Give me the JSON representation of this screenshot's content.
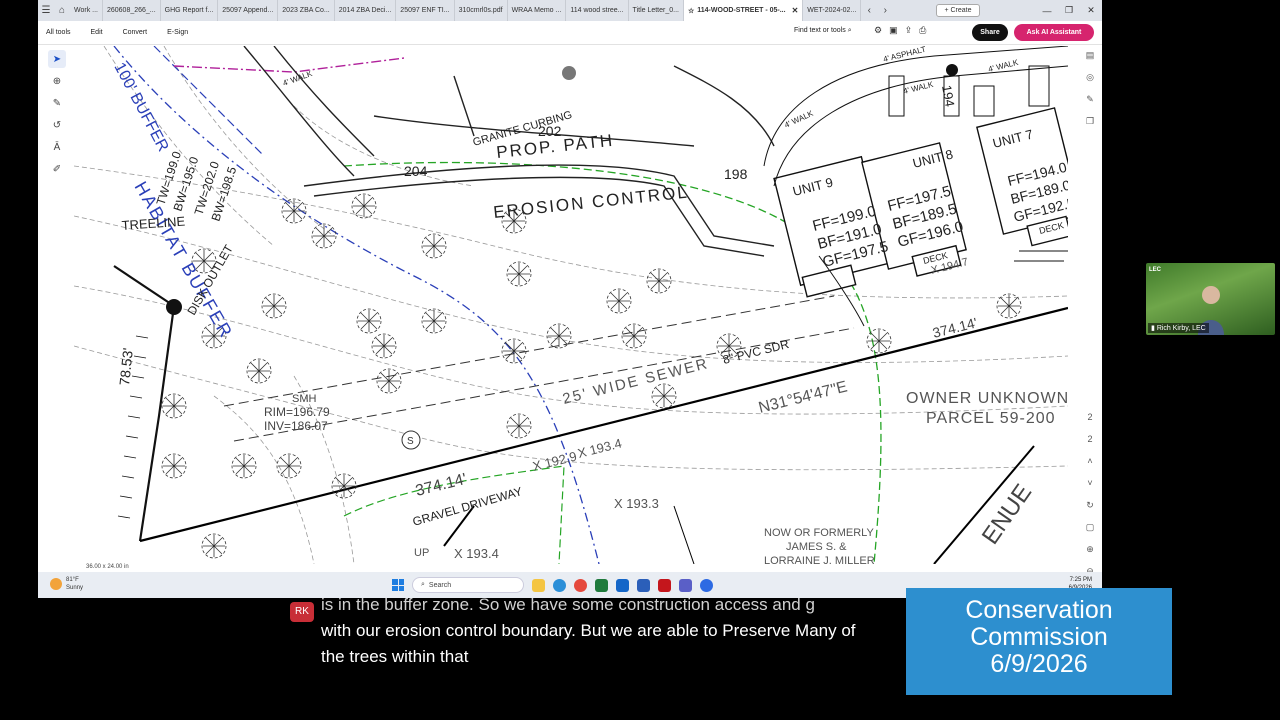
{
  "browser": {
    "tabs": [
      {
        "label": "Work ..."
      },
      {
        "label": "260608_266_..."
      },
      {
        "label": "GHG Report f..."
      },
      {
        "label": "25097 Append..."
      },
      {
        "label": "2023 ZBA Co..."
      },
      {
        "label": "2014 ZBA Deci..."
      },
      {
        "label": "25097 ENF TI..."
      },
      {
        "label": "310cmrl0s.pdf"
      },
      {
        "label": "WRAA Memo ..."
      },
      {
        "label": "114 wood stree..."
      },
      {
        "label": "Title Letter_0..."
      },
      {
        "label": "114-WOOD-STREET - 05-..."
      },
      {
        "label": "WET-2024-02..."
      }
    ],
    "create_label": "+ Create"
  },
  "toolbar": {
    "menu": [
      "All tools",
      "Edit",
      "Convert",
      "E-Sign"
    ],
    "find_label": "Find text or tools",
    "share_label": "Share",
    "ai_label": "Ask AI Assistant"
  },
  "drawing": {
    "labels": {
      "habitat_buffer": "HABITAT BUFFER",
      "buffer_100": "100' BUFFER",
      "granite_curbing": "GRANITE CURBING",
      "prop_path": "PROP. PATH",
      "erosion_control": "EROSION CONTROL",
      "treeline": "TREELINE",
      "disk_outlet": "DISK OUTLET",
      "unit9": "UNIT 9",
      "unit8": "UNIT 8",
      "unit7": "UNIT 7",
      "unit9_ff": "FF=199.0",
      "unit9_bf": "BF=191.0",
      "unit9_gf": "GF=197.5",
      "unit8_ff": "FF=197.5",
      "unit8_bf": "BF=189.5",
      "unit8_gf": "GF=196.0",
      "unit7_ff": "FF=194.0",
      "unit7_bf": "BF=189.0",
      "unit7_gf": "GF=192.5",
      "deck": "DECK",
      "walk": "4' WALK",
      "asphalt": "4' ASPHALT",
      "sewer": "25' WIDE SEWER",
      "pvc": "8\" PVC SDR",
      "bearing": "N31°54'47\"E",
      "owner": "OWNER UNKNOWN",
      "parcel": "PARCEL 59-200",
      "formerly": "NOW OR FORMERLY",
      "james": "JAMES S. &",
      "lorraine": "LORRAINE J. MILLER",
      "driveway": "GRAVEL DRIVEWAY",
      "dist1": "374.14'",
      "dist2": "374.14'",
      "smh": "SMH",
      "rim": "RIM=196.79",
      "inv": "INV=186.07",
      "tw1": "TW=199.0",
      "bw1": "BW=195.0",
      "tw2": "TW=202.0",
      "bw2": "BW=198.5",
      "c202": "202",
      "c204": "204",
      "c198": "198",
      "c194": "194",
      "avenue": "ENUE",
      "spot1": "X 192.9",
      "spot2": "X 193.4",
      "spot3": "X 193.3",
      "spot4": "X 193.4",
      "spot5": "X 194.7",
      "dim1": "78.53'",
      "up": "UP"
    },
    "page_size": "36.00 x 24.00 in"
  },
  "taskbar": {
    "temp": "81°F",
    "weather": "Sunny",
    "search": "Search",
    "time": "7:25 PM",
    "date": "6/9/2026"
  },
  "webcam": {
    "name": "Rich Kirby, LEC",
    "logo": "LEC"
  },
  "captions": {
    "speaker": "RK",
    "line1": "is in the buffer zone. So we have some construction access and g",
    "line2": "with our erosion control boundary. But we are able to Preserve Many of",
    "line3": "the trees within that"
  },
  "overlay": {
    "line1": "Conservation",
    "line2": "Commission",
    "line3": "6/9/2026"
  }
}
